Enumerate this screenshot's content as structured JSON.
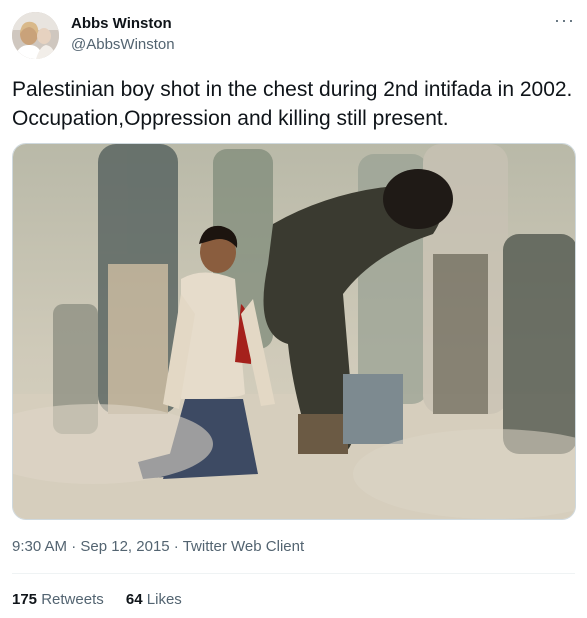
{
  "author": {
    "name": "Abbs Winston",
    "handle": "@AbbsWinston"
  },
  "tweet": {
    "text": "Palestinian boy shot in the chest during 2nd intifada in 2002. Occupation,Oppression and killing still present."
  },
  "meta": {
    "time": "9:30 AM",
    "sep1": " · ",
    "date": "Sep 12, 2015",
    "sep2": " · ",
    "client": "Twitter Web Client"
  },
  "stats": {
    "retweets_count": "175",
    "retweets_label": "Retweets",
    "likes_count": "64",
    "likes_label": "Likes"
  },
  "icons": {
    "more": "more-dots-icon"
  },
  "colors": {
    "text": "#0f1419",
    "secondary": "#536471",
    "border": "#cfd9de"
  }
}
